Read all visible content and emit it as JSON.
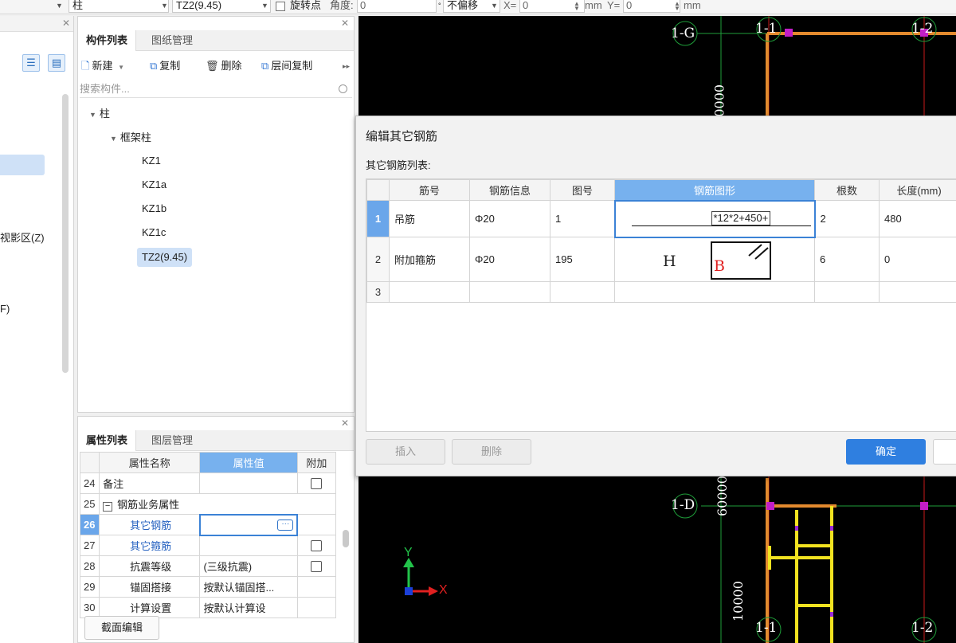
{
  "toolbar": {
    "type_select": "柱",
    "component_select": "TZ2(9.45)",
    "rotate_point_label": "旋转点",
    "angle_label": "角度:",
    "angle_value": "0",
    "offset_select": "不偏移",
    "x_label": "X=",
    "x_value": "0",
    "mm_label_1": "mm",
    "y_label": "Y=",
    "y_value": "0",
    "mm_label_2": "mm"
  },
  "left_panel": {
    "item_1": "视影区(Z)",
    "item_2": "F)"
  },
  "component_panel": {
    "tabs": [
      "构件列表",
      "图纸管理"
    ],
    "tools": {
      "new": "新建",
      "copy": "复制",
      "delete": "删除",
      "layer_copy": "层间复制"
    },
    "search_placeholder": "搜索构件...",
    "tree": {
      "root": "柱",
      "group": "框架柱",
      "items": [
        "KZ1",
        "KZ1a",
        "KZ1b",
        "KZ1c",
        "TZ2(9.45)"
      ]
    }
  },
  "property_panel": {
    "tabs": [
      "属性列表",
      "图层管理"
    ],
    "headers": {
      "name": "属性名称",
      "value": "属性值",
      "extra": "附加"
    },
    "rows": [
      {
        "num": "24",
        "name": "备注",
        "value": ""
      },
      {
        "num": "25",
        "name": "钢筋业务属性",
        "value": ""
      },
      {
        "num": "26",
        "name": "其它钢筋",
        "value": ""
      },
      {
        "num": "27",
        "name": "其它箍筋",
        "value": ""
      },
      {
        "num": "28",
        "name": "抗震等级",
        "value": "(三级抗震)"
      },
      {
        "num": "29",
        "name": "锚固搭接",
        "value": "按默认锚固搭..."
      },
      {
        "num": "30",
        "name": "计算设置",
        "value": "按默认计算设"
      }
    ],
    "collapse_sign": "−",
    "section_edit_button": "截面编辑"
  },
  "dialog": {
    "title": "编辑其它钢筋",
    "subtitle": "其它钢筋列表:",
    "columns": [
      "筋号",
      "钢筋信息",
      "图号",
      "钢筋图形",
      "根数",
      "长度(mm)"
    ],
    "rows": [
      {
        "num": "1",
        "name": "吊筋",
        "info": "Φ20",
        "fig": "1",
        "shape_formula": "*12*2+450+",
        "count": "2",
        "length": "480"
      },
      {
        "num": "2",
        "name": "附加箍筋",
        "info": "Φ20",
        "fig": "195",
        "shape_h": "H",
        "shape_b": "B",
        "count": "6",
        "length": "0"
      },
      {
        "num": "3",
        "name": "",
        "info": "",
        "fig": "",
        "count": "",
        "length": ""
      }
    ],
    "buttons": {
      "insert": "插入",
      "delete": "删除",
      "ok": "确定"
    }
  },
  "cad": {
    "axis_labels": {
      "g": "1-G",
      "col_1": "1-1",
      "col_2": "1-2",
      "d": "1-D",
      "col_1_bottom": "1-1",
      "col_2_bottom": "1-2"
    },
    "dims": {
      "top": "0000",
      "mid": "60000",
      "bottom": "10000"
    },
    "ucs": {
      "x": "X",
      "y": "Y"
    }
  }
}
